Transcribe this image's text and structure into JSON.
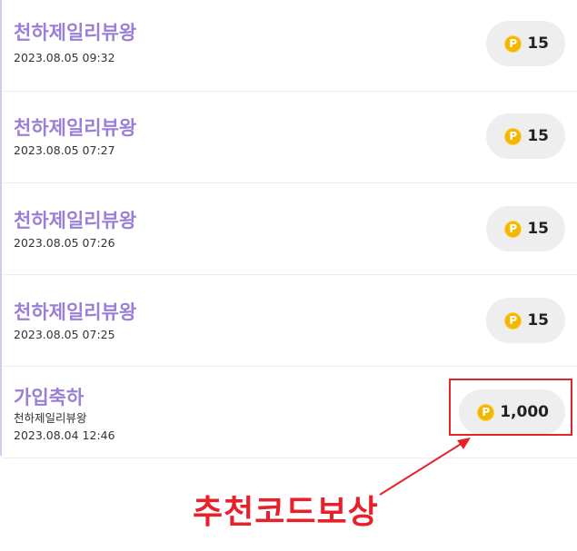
{
  "history": [
    {
      "title": "천하제일리뷰왕",
      "date": "2023.08.05 09:32",
      "points": "15"
    },
    {
      "title": "천하제일리뷰왕",
      "date": "2023.08.05 07:27",
      "points": "15"
    },
    {
      "title": "천하제일리뷰왕",
      "date": "2023.08.05 07:26",
      "points": "15"
    },
    {
      "title": "천하제일리뷰왕",
      "date": "2023.08.05 07:25",
      "points": "15"
    },
    {
      "title": "가입축하",
      "description": "천하제일리뷰왕",
      "date": "2023.08.04 12:46",
      "points": "1,000"
    }
  ],
  "coin_symbol": "P",
  "annotation": {
    "text": "추천코드보상"
  },
  "colors": {
    "title": "#9b7fd6",
    "coin": "#f2b705",
    "pill_bg": "#eeeeee",
    "annotation": "#e8202a"
  },
  "icons": {
    "coin": "point-coin-icon",
    "arrow": "arrow-icon"
  }
}
